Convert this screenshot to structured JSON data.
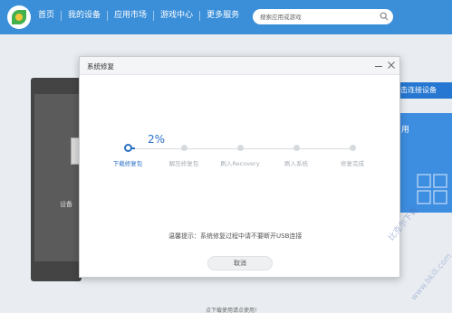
{
  "header": {
    "nav": [
      "首页",
      "我的设备",
      "应用市场",
      "游戏中心",
      "更多服务"
    ],
    "search_placeholder": "搜索应用或游戏"
  },
  "background": {
    "device_text": "设备",
    "connect_button": "击连接设备",
    "panel_text": "用",
    "bottom_text": "点下载使用请点使用！"
  },
  "dialog": {
    "title": "系统修复",
    "progress_percent": "2%",
    "progress_fraction": 0.02,
    "steps": [
      "下载修复包",
      "解压修复包",
      "刷入Recovery",
      "刷入系统",
      "修复完成"
    ],
    "active_step": 0,
    "hint": "温馨提示：系统修复过程中请不要断开USB连接",
    "cancel_label": "取消"
  },
  "watermark": {
    "line1": "比克尔下载",
    "line2": "www.bkill.com"
  },
  "colors": {
    "header_blue": "#3b8fd9",
    "accent_blue": "#2a72c6",
    "connect_blue": "#2677d1"
  }
}
